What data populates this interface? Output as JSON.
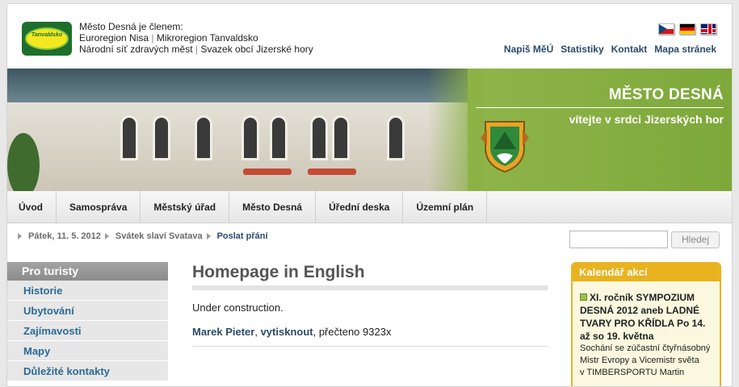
{
  "header": {
    "logo_text": "Tanvaldsko",
    "member_title": "Město Desná je členem:",
    "member_line1": [
      "Euroregion Nisa",
      "Mikroregion Tanvaldsko"
    ],
    "member_line2": [
      "Národní síť zdravých měst",
      "Svazek obcí Jizerské hory"
    ],
    "separator": "|",
    "flags": [
      "flag-cz",
      "flag-de",
      "flag-uk"
    ],
    "links": [
      "Napiš MěÚ",
      "Statistiky",
      "Kontakt",
      "Mapa stránek"
    ]
  },
  "banner": {
    "title": "MĚSTO DESNÁ",
    "slogan": "vítejte v srdci Jizerských hor",
    "crest_icon": "town-crest-icon"
  },
  "nav": [
    "Úvod",
    "Samospráva",
    "Městský úřad",
    "Město Desná",
    "Úřední deska",
    "Územní plán"
  ],
  "infobar": {
    "date": "Pátek, 11. 5. 2012",
    "nameday": "Svátek slaví Svatava",
    "greeting_link": "Poslat přání",
    "search_placeholder": "",
    "search_button": "Hledej"
  },
  "sidebar": {
    "heading": "Pro turisty",
    "items": [
      "Historie",
      "Ubytování",
      "Zajímavosti",
      "Mapy",
      "Důležité kontakty"
    ]
  },
  "main": {
    "title": "Homepage in English",
    "text": "Under construction.",
    "author": "Marek Pieter",
    "comma": ",",
    "print_link": "vytisknout",
    "read_count": ", přečteno 9323x"
  },
  "calendar": {
    "heading": "Kalendář akcí",
    "event_title": "XI. ročník SYMPOZIUM DESNÁ 2012 aneb LADNÉ TVARY PRO KŘÍDLA Po 14. až so 19. května",
    "event_text1": "Sochání se zúčastní čtyřnásobný Mistr Evropy a Vicemistr světa",
    "event_text2": "v TIMBERSPORTU Martin"
  },
  "colors": {
    "accent_green": "#7da83a",
    "calendar_orange": "#e9b21f",
    "link_blue": "#2b6a97"
  }
}
